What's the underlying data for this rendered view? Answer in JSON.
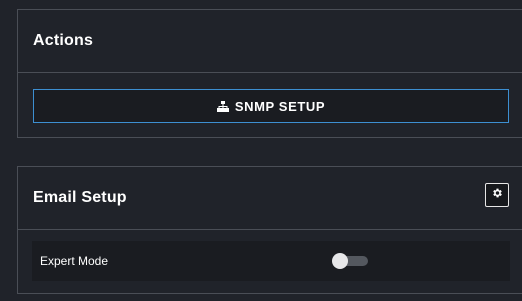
{
  "actions": {
    "title": "Actions",
    "snmp_button_label": "SNMP SETUP",
    "snmp_icon": "sitemap-icon"
  },
  "email": {
    "title": "Email Setup",
    "settings_icon": "gear-icon",
    "expert_mode_label": "Expert Mode",
    "expert_mode_enabled": false
  },
  "colors": {
    "background": "#20232a",
    "border": "#4a4e56",
    "accent": "#3d8fd1",
    "row_background": "#1a1c21"
  }
}
